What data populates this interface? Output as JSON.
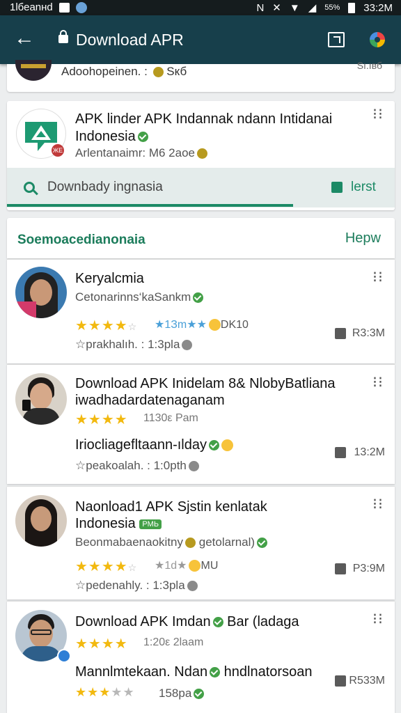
{
  "status_bar": {
    "carrier": "1lбеanнd",
    "battery": "55%",
    "time": "33:2M"
  },
  "app_bar": {
    "title": "Download APR"
  },
  "top_card": {
    "meta": "Adoohopeinen. : ",
    "meta_tail": "Sкб",
    "right": "Sı.ıвб"
  },
  "featured": {
    "title_line1": "APK linder APK Indannak ndann Intidanai",
    "title_line2": "Indonesia",
    "meta": "Arlentanaimr: M6 2aoe",
    "icon_badge": "ЖЕ",
    "search_text": "Downbady ingnasia",
    "action_label": "lerst"
  },
  "section": {
    "title": "Soemoacedianonaia",
    "action": "Hepw"
  },
  "items": [
    {
      "title_line1": "Keryalcmia",
      "title_line2": "",
      "subtitle": "Cetonarinns‘kaSankm",
      "stars_on": 4,
      "stars_total": 5,
      "rating_text": "1Зm",
      "rating_extra": "DK10",
      "line3": "prakhalıh. : 1:3pla",
      "line3_prefix": "☆",
      "count": "R3:3M"
    },
    {
      "title_line1": "Download APK Inidelam 8& NlobyBatliana",
      "title_line2": "iwadhadardatenaganam",
      "subtitle": "",
      "stars_on": 4,
      "stars_total": 4,
      "rating_text": "1130ε Pam",
      "rating_extra": "",
      "line3_title": "Iriocliagefltaann-ılday",
      "line3": "peakoalah. : 1:0pth",
      "line3_prefix": "☆",
      "count": "13:2M"
    },
    {
      "title_line1": "Naonload1 APK Sjstin kenlatak",
      "title_line2": "Indonesia",
      "tag": "PMЬ",
      "subtitle": "Beonmabaenaokitny",
      "subtitle_tail": "getolarnal)",
      "stars_on": 4,
      "stars_total": 5,
      "rating_text": "1d",
      "rating_extra": "MU",
      "line3": "pedenahly. : 1:3pla",
      "line3_prefix": "☆",
      "count": "P3:9M"
    },
    {
      "title_line1": "Download APK Imdan",
      "title_line1_tail": "Bar (ladaga",
      "stars_on": 4,
      "stars_total": 4,
      "rating_text": "1:20ε 2laam",
      "line3_title": "Mannlmtekaan. Ndan",
      "line3_title_tail": "hndlnatorsoan",
      "bottom_stars_on": 3,
      "bottom_stars_total": 5,
      "line4": "158pa",
      "count": "R533M"
    }
  ]
}
